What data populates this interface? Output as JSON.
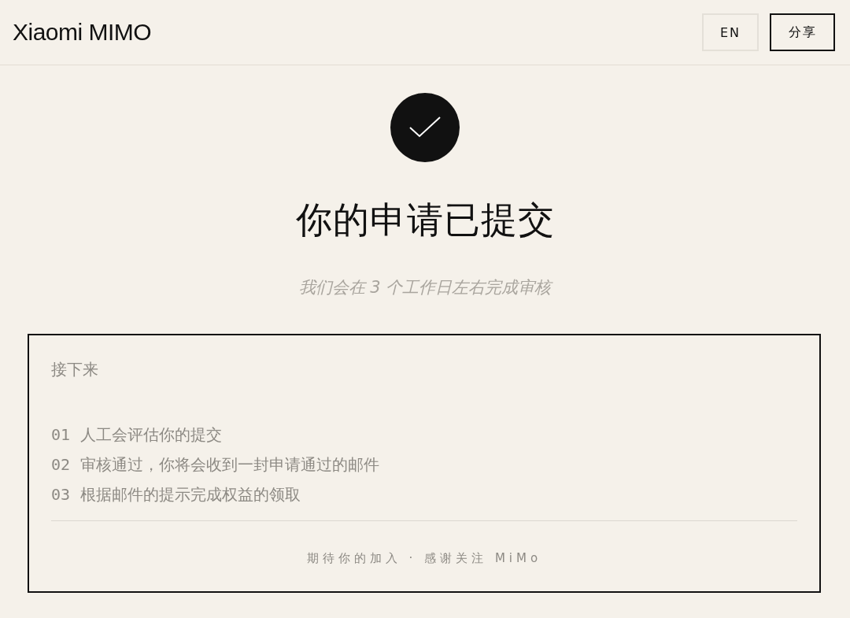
{
  "header": {
    "logo": "Xiaomi MIMO",
    "buttons": [
      {
        "label": "EN",
        "kind": "plain"
      },
      {
        "label": "分享",
        "kind": "outlined"
      }
    ]
  },
  "status": {
    "title": "你的申请已提交",
    "subtitle": "我们会在 3 个工作日左右完成审核"
  },
  "next_steps": {
    "heading": "接下来",
    "steps": [
      {
        "number": "01",
        "text": "人工会评估你的提交"
      },
      {
        "number": "02",
        "text": "审核通过，你将会收到一封申请通过的邮件"
      },
      {
        "number": "03",
        "text": "根据邮件的提示完成权益的领取"
      }
    ],
    "footer": "期待你的加入 · 感谢关注 MiMo"
  }
}
